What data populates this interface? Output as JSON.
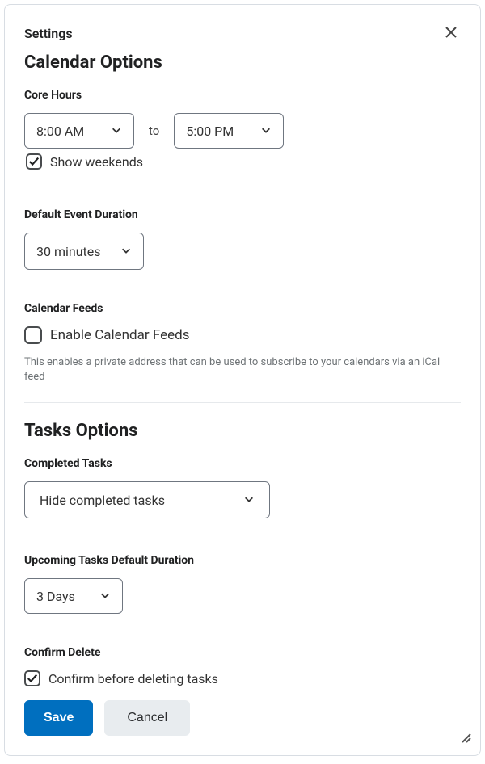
{
  "header": {
    "settings_label": "Settings"
  },
  "calendar": {
    "title": "Calendar Options",
    "core_hours": {
      "label": "Core Hours",
      "start": "8:00 AM",
      "to_label": "to",
      "end": "5:00 PM",
      "show_weekends_label": "Show weekends",
      "show_weekends_checked": true
    },
    "default_duration": {
      "label": "Default Event Duration",
      "value": "30 minutes"
    },
    "feeds": {
      "label": "Calendar Feeds",
      "checkbox_label": "Enable Calendar Feeds",
      "checked": false,
      "helper": "This enables a private address that can be used to subscribe to your calendars via an iCal feed"
    }
  },
  "tasks": {
    "title": "Tasks Options",
    "completed": {
      "label": "Completed Tasks",
      "value": "Hide completed tasks"
    },
    "upcoming_duration": {
      "label": "Upcoming Tasks Default Duration",
      "value": "3 Days"
    },
    "confirm_delete": {
      "label": "Confirm Delete",
      "checkbox_label": "Confirm before deleting tasks",
      "checked": true
    }
  },
  "footer": {
    "save_label": "Save",
    "cancel_label": "Cancel"
  }
}
